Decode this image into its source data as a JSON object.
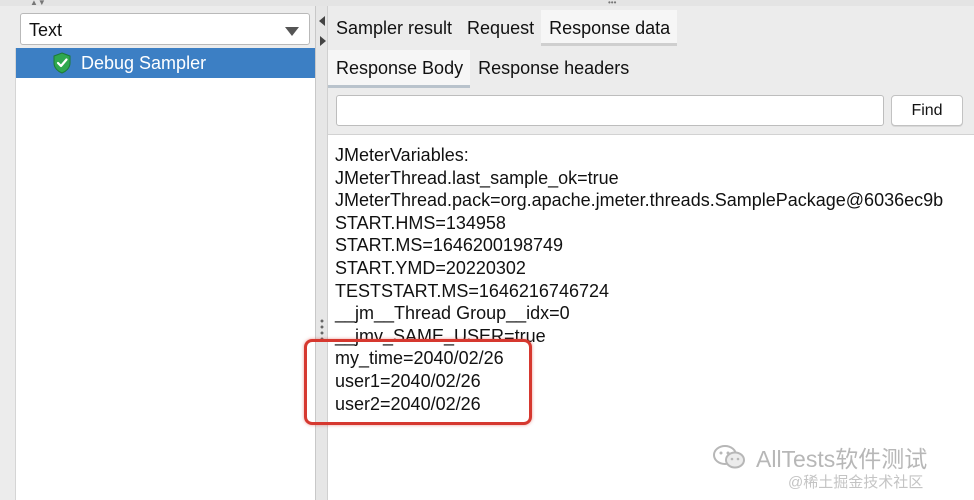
{
  "renderer": {
    "selected": "Text"
  },
  "tree": {
    "items": [
      {
        "label": "Debug Sampler",
        "icon": "success-shield-icon",
        "selected": true
      }
    ]
  },
  "tabs": {
    "main": [
      {
        "label": "Sampler result"
      },
      {
        "label": "Request"
      },
      {
        "label": "Response data",
        "selected": true
      }
    ],
    "sub": [
      {
        "label": "Response Body",
        "selected": true
      },
      {
        "label": "Response headers"
      }
    ]
  },
  "search": {
    "value": "",
    "find_label": "Find"
  },
  "response": {
    "lines": [
      "JMeterVariables:",
      "JMeterThread.last_sample_ok=true",
      "JMeterThread.pack=org.apache.jmeter.threads.SamplePackage@6036ec9b",
      "START.HMS=134958",
      "START.MS=1646200198749",
      "START.YMD=20220302",
      "TESTSTART.MS=1646216746724",
      "__jm__Thread Group__idx=0",
      "__jmv_SAME_USER=true",
      "my_time=2040/02/26",
      "user1=2040/02/26",
      "user2=2040/02/26"
    ]
  },
  "watermark": {
    "main": "AllTests软件测试",
    "sub": "@稀土掘金技术社区"
  },
  "colors": {
    "selection": "#3c7fc4",
    "highlight": "#d6382f",
    "shield": "#2fa84f"
  }
}
